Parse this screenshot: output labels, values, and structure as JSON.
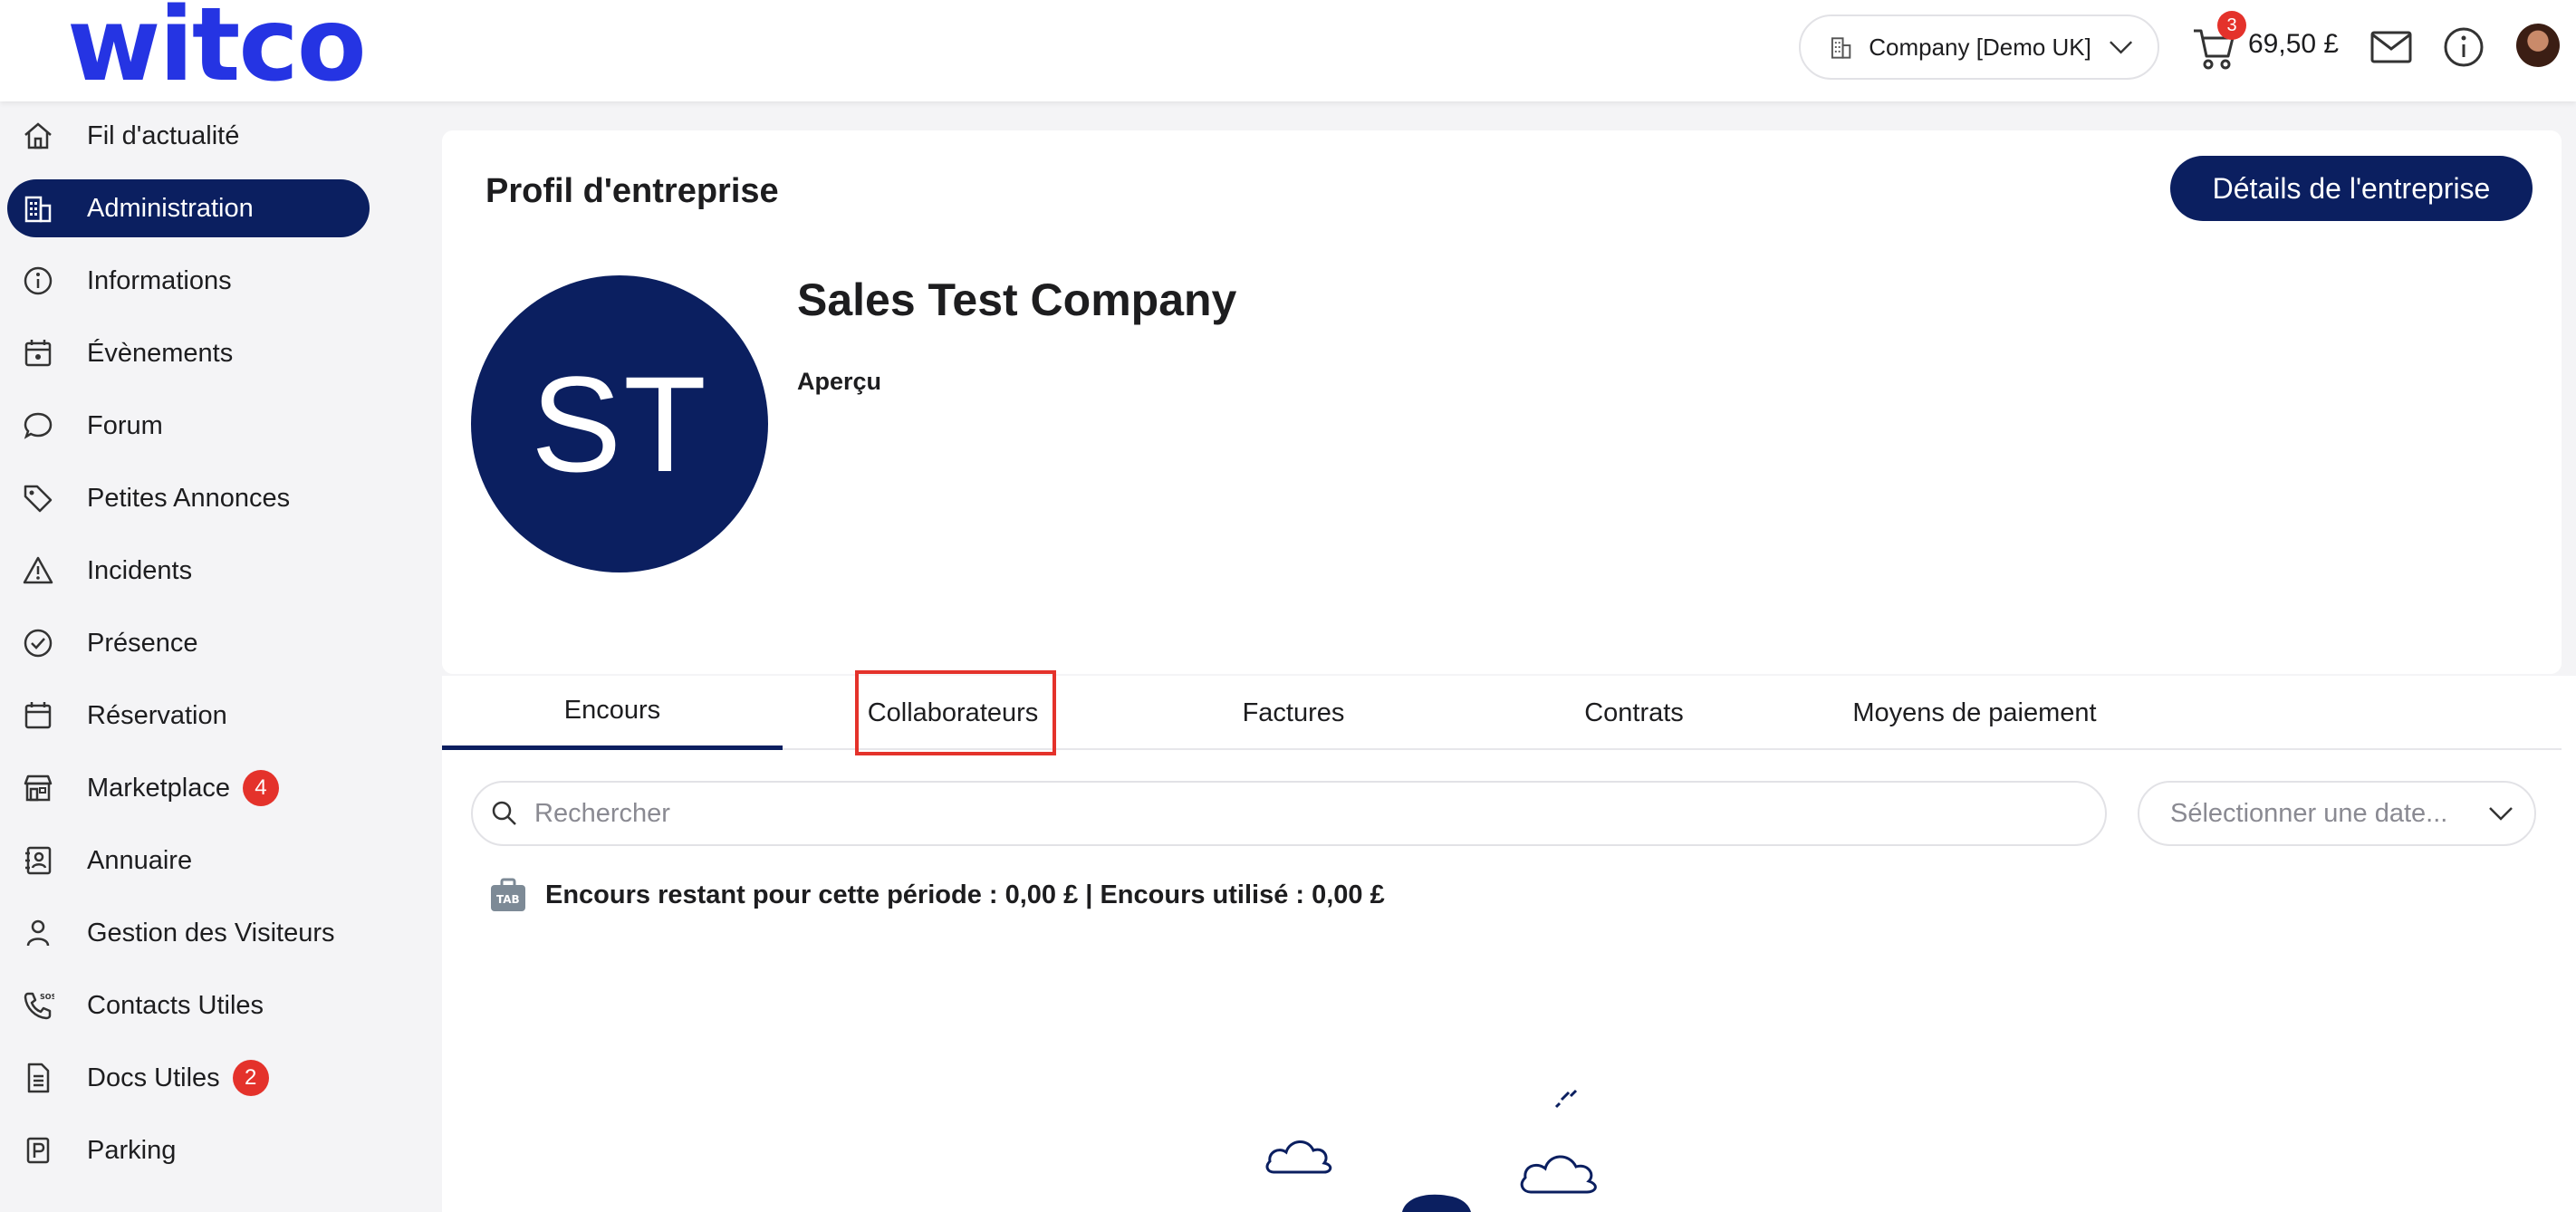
{
  "header": {
    "logo_text": "witco",
    "company_selector": {
      "label": "Company [Demo UK]"
    },
    "cart": {
      "count": "3",
      "amount": "69,50 £"
    },
    "icons": [
      "building-icon",
      "chevron-down-icon",
      "cart-icon",
      "mail-icon",
      "info-icon",
      "avatar"
    ]
  },
  "sidebar": {
    "items": [
      {
        "label": "Fil d'actualité",
        "icon": "home-icon"
      },
      {
        "label": "Administration",
        "icon": "building-icon",
        "active": true
      },
      {
        "label": "Informations",
        "icon": "info-icon"
      },
      {
        "label": "Évènements",
        "icon": "calendar-event-icon"
      },
      {
        "label": "Forum",
        "icon": "chat-bubble-icon"
      },
      {
        "label": "Petites Annonces",
        "icon": "tag-icon"
      },
      {
        "label": "Incidents",
        "icon": "warning-icon"
      },
      {
        "label": "Présence",
        "icon": "check-circle-icon"
      },
      {
        "label": "Réservation",
        "icon": "calendar-icon"
      },
      {
        "label": "Marketplace",
        "icon": "store-icon",
        "badge": "4"
      },
      {
        "label": "Annuaire",
        "icon": "contact-book-icon"
      },
      {
        "label": "Gestion des Visiteurs",
        "icon": "person-icon"
      },
      {
        "label": "Contacts Utiles",
        "icon": "phone-sos-icon"
      },
      {
        "label": "Docs Utiles",
        "icon": "document-icon",
        "badge": "2"
      },
      {
        "label": "Parking",
        "icon": "parking-icon"
      }
    ]
  },
  "main": {
    "page_title": "Profil d'entreprise",
    "details_button": "Détails de l'entreprise",
    "company": {
      "initials": "ST",
      "name": "Sales Test Company",
      "overview_label": "Aperçu"
    },
    "tabs": [
      {
        "label": "Encours",
        "active": true
      },
      {
        "label": "Collaborateurs",
        "highlighted": true
      },
      {
        "label": "Factures"
      },
      {
        "label": "Contrats"
      },
      {
        "label": "Moyens de paiement"
      }
    ],
    "search": {
      "placeholder": "Rechercher",
      "value": ""
    },
    "date_select": {
      "placeholder": "Sélectionner une date..."
    },
    "credit_text": "Encours restant pour cette période : 0,00 £ | Encours utilisé : 0,00 £"
  },
  "colors": {
    "brand_blue": "#2534e3",
    "navy": "#0b1f60",
    "badge_red": "#e4322b",
    "highlight_red": "#e4322b"
  }
}
